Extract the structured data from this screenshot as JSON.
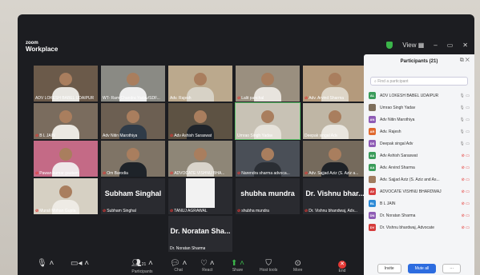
{
  "app": {
    "logo_top": "zoom",
    "logo_bottom": "Workplace"
  },
  "titlebar": {
    "view_label": "View",
    "minimize": "–",
    "maximize": "▭",
    "close": "✕"
  },
  "tiles": [
    {
      "name": "ADV LOKESH BABEL UDAIPUR",
      "muted": false,
      "bg": "#6b5a4a",
      "shirt": "#e7e5e0"
    },
    {
      "name": "WT- Ram Chandra Yadav/SDF...",
      "muted": false,
      "bg": "#8a8a84",
      "shirt": "#eeeeee"
    },
    {
      "name": "Adv. Rajesh",
      "muted": false,
      "bg": "#bba98d",
      "shirt": "#d7d2c6"
    },
    {
      "name": "Lalit panchal",
      "muted": true,
      "bg": "#9a8f7f",
      "shirt": "#e8e4de"
    },
    {
      "name": "Adv. Arvind Sharma",
      "muted": true,
      "bg": "#b49a7c",
      "shirt": "#ddd5c7"
    },
    {
      "name": "B L JAIN",
      "muted": true,
      "bg": "#7a6c5e",
      "shirt": "#ebe8e2"
    },
    {
      "name": "Adv Nitin Marothiya",
      "muted": false,
      "bg": "#6c5f52",
      "shirt": "#2f3b48"
    },
    {
      "name": "Adv Ashish Saraswat",
      "muted": true,
      "bg": "#5d5243",
      "shirt": "#1f242b"
    },
    {
      "name": "Umrao Singh Yadav",
      "muted": false,
      "bg": "#c8c2b5",
      "shirt": "#e6e2da"
    },
    {
      "name": "Deepak singal Adv",
      "muted": false,
      "bg": "#bfb6a5",
      "shirt": "#e9e6df"
    },
    {
      "name": "Pawan kumar gautam",
      "muted": true,
      "bg": "#c46a86",
      "shirt": "#efe7ea"
    },
    {
      "name": "Om Barodia",
      "muted": true,
      "bg": "#7f7466",
      "shirt": "#1e2329"
    },
    {
      "name": "ADVOCATE VISHNU BHA...",
      "muted": true,
      "bg": "#8e8677",
      "shirt": "#d9d4cb"
    },
    {
      "name": "Narendra sharma advoca...",
      "muted": true,
      "bg": "#4a4f57",
      "shirt": "#2a2e34"
    },
    {
      "name": "Adv. Sajjad Aziz (S. Aziz a...",
      "muted": true,
      "bg": "#756a5c",
      "shirt": "#1e2227"
    },
    {
      "name": "Murali Mohan Gupta",
      "muted": true,
      "bg": "#d6d0c3",
      "shirt": "#eeebe5"
    },
    {
      "name": "Subham Singhal",
      "muted": true,
      "big": "Subham Singhal"
    },
    {
      "name": "TANUJ AGRAWAL",
      "muted": true,
      "bg": "#f2f2f2",
      "shirt": "#f2f2f2",
      "blank": true
    },
    {
      "name": "shubha mundra",
      "muted": true,
      "big": "shubha mundra"
    },
    {
      "name": "Dr. Vishnu bhandwaj, Adv...",
      "muted": true,
      "big": "Dr. Vishnu bhar..."
    },
    {
      "name": "Dr. Noratan Sharma",
      "muted": false,
      "big": "Dr. Noratan Sha..."
    }
  ],
  "toolbar": {
    "audio": "Audio",
    "video": "Video",
    "participants": "Participants",
    "participants_count": "21",
    "chat": "Chat",
    "react": "React",
    "share": "Share",
    "host_tools": "Host tools",
    "more": "More",
    "end": "End"
  },
  "panel": {
    "title": "Participants (21)",
    "search_placeholder": "Find a participant",
    "invite": "Invite",
    "mute_all": "Mute all",
    "more": "···"
  },
  "participants": [
    {
      "initials": "AL",
      "name": "ADV LOKESH BABEL UDAIPUR",
      "color": "#3a9c5a",
      "muted": false
    },
    {
      "initials": "",
      "name": "Umrao Singh Yadav",
      "color": "#7d6e5c",
      "muted": false,
      "photo": true
    },
    {
      "initials": "AN",
      "name": "Adv Nitin Marothiya",
      "color": "#8e5bb5",
      "muted": false
    },
    {
      "initials": "AR",
      "name": "Adv. Rajesh",
      "color": "#e0682d",
      "muted": false
    },
    {
      "initials": "DS",
      "name": "Deepak singal Adv",
      "color": "#8e5bb5",
      "muted": false
    },
    {
      "initials": "AA",
      "name": "Adv Ashish Saraswat",
      "color": "#3a9c5a",
      "muted": true
    },
    {
      "initials": "AA",
      "name": "Adv. Arvind Sharma",
      "color": "#3a9c5a",
      "muted": true
    },
    {
      "initials": "",
      "name": "Adv. Sajjad Aziz (S. Aziz and As...",
      "color": "#a07c60",
      "muted": true,
      "photo": true
    },
    {
      "initials": "AV",
      "name": "ADVOCATE VISHNU BHARDWAJ",
      "color": "#d63c3c",
      "muted": true
    },
    {
      "initials": "BL",
      "name": "B L JAIN",
      "color": "#2d8ad6",
      "muted": true
    },
    {
      "initials": "DN",
      "name": "Dr. Noratan Sharma",
      "color": "#8e5bb5",
      "muted": true
    },
    {
      "initials": "DV",
      "name": "Dr. Vishnu bhardwaj, Advocate",
      "color": "#d63c3c",
      "muted": true
    }
  ],
  "colors": {
    "muted_red": "#e53935",
    "active_speaker": "#5ec26a",
    "shield": "#3bb54a"
  }
}
